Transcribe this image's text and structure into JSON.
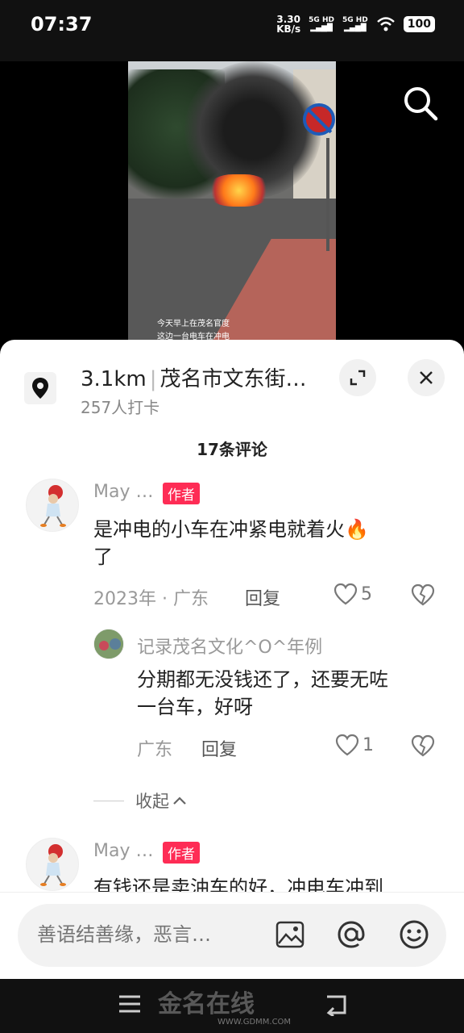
{
  "status": {
    "time": "07:37",
    "speed_value": "3.30",
    "speed_unit": "KB/s",
    "net1": "5G HD",
    "net2": "5G HD",
    "battery": "100"
  },
  "video": {
    "caption_line1": "今天早上在茂名官度",
    "caption_line2": "这边一台电车在冲电"
  },
  "location": {
    "distance": "3.1km",
    "name": "茂名市文东街…",
    "checkins": "257人打卡"
  },
  "comments_header": "17条评论",
  "comments": [
    {
      "user": "May …",
      "badge": "作者",
      "text_line1": "是冲电的小车在冲紧电就着火🔥",
      "text_line2": "了",
      "date_loc": "2023年 · 广东",
      "reply_label": "回复",
      "likes": "5"
    },
    {
      "user": "记录茂名文化^O^年例",
      "text_line1": "分期都无没钱还了，还要无咗",
      "text_line2": "一台车，好呀",
      "date_loc": "广东",
      "reply_label": "回复",
      "likes": "1"
    },
    {
      "user": "May …",
      "badge": "作者",
      "text_line1": "有钱还是卖油车的好，冲电车冲到"
    }
  ],
  "collapse_label": "收起",
  "input": {
    "placeholder": "善语结善缘，恶言…"
  },
  "watermark": {
    "text": "金名在线",
    "url": "WWW.GDMM.COM"
  },
  "colors": {
    "accent": "#fe2c55",
    "sheet_bg": "#ffffff",
    "input_bg": "#f2f2f2"
  }
}
